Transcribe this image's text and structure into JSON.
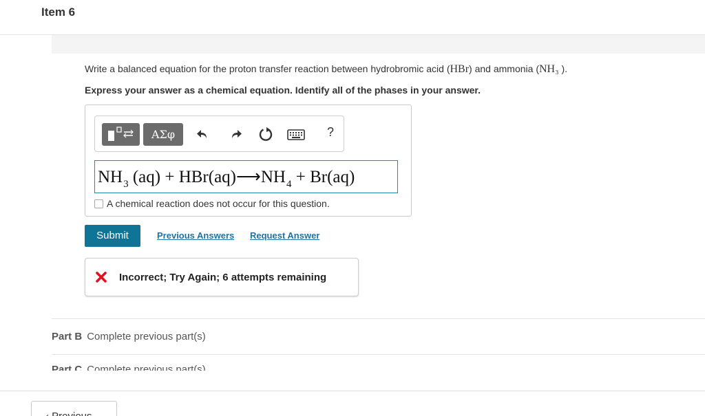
{
  "item": {
    "title": "Item 6"
  },
  "question": {
    "prefix": "Write a balanced equation for the proton transfer reaction between hydrobromic acid (",
    "acid_formula": "HBr",
    "middle": ") and ammonia (",
    "base_formula": "NH₃",
    "suffix": " ).",
    "instruction": "Express your answer as a chemical equation. Identify all of the phases in your answer."
  },
  "toolbar": {
    "templates_icon": "templates-icon",
    "greek_label": "ΑΣφ",
    "undo_icon": "undo-icon",
    "redo_icon": "redo-icon",
    "reset_icon": "reset-icon",
    "keyboard_icon": "keyboard-icon",
    "help_label": "?"
  },
  "answer": {
    "t1": "NH",
    "s1": "3",
    "t2": " (aq) + HBr(aq)⟶NH",
    "s2": "4",
    "t3": " + Br(aq)"
  },
  "no_reaction": {
    "label": "A chemical reaction does not occur for this question.",
    "checked": false
  },
  "actions": {
    "submit_label": "Submit",
    "previous_answers_label": "Previous Answers",
    "request_answer_label": "Request Answer"
  },
  "feedback": {
    "icon": "x-icon",
    "text": "Incorrect; Try Again; 6 attempts remaining",
    "color": "#e0121b"
  },
  "parts": [
    {
      "label": "Part B",
      "status": "Complete previous part(s)"
    },
    {
      "label": "Part C",
      "status": "Complete previous part(s)"
    }
  ],
  "navigation": {
    "previous_label": "‹ Previous"
  },
  "colors": {
    "accent": "#0e7597",
    "link": "#1a73a7",
    "input_border": "#1e88b3"
  }
}
